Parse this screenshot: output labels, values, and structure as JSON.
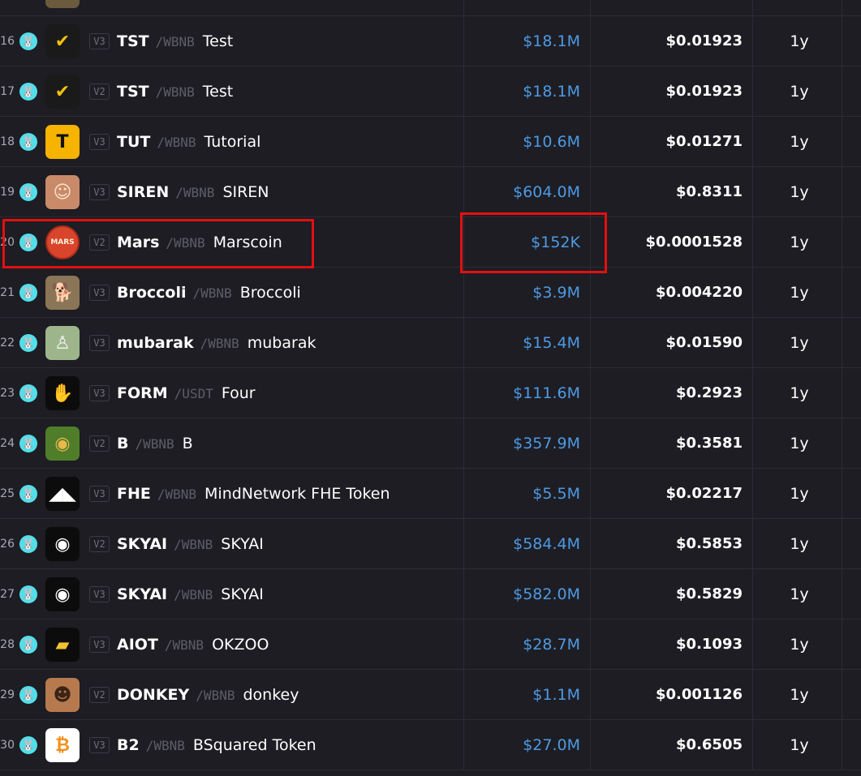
{
  "colors": {
    "background": "#1d1d23",
    "divider": "#2c2c34",
    "liquidity_text": "#4e9ae4",
    "highlight": "#e31010",
    "chain_badge": "#53dee9"
  },
  "rows": [
    {
      "index": "",
      "logo_icon": "partial-logo-icon",
      "logo_bg": "#6b5a3e",
      "logo_fg": "#d6b87a",
      "logo_glyph": "",
      "version": "",
      "symbol": "",
      "pair": "",
      "name": "",
      "liquidity": "",
      "price": "",
      "age": ""
    },
    {
      "index": "16",
      "logo_icon": "checkmark-logo-icon",
      "logo_bg": "#1a1a1a",
      "logo_fg": "#f4c20d",
      "logo_glyph": "✔",
      "version": "V3",
      "symbol": "TST",
      "pair": "/WBNB",
      "name": "Test",
      "liquidity": "$18.1M",
      "price": "$0.01923",
      "age": "1y"
    },
    {
      "index": "17",
      "logo_icon": "checkmark-logo-icon",
      "logo_bg": "#1a1a1a",
      "logo_fg": "#f4c20d",
      "logo_glyph": "✔",
      "version": "V2",
      "symbol": "TST",
      "pair": "/WBNB",
      "name": "Test",
      "liquidity": "$18.1M",
      "price": "$0.01923",
      "age": "1y"
    },
    {
      "index": "18",
      "logo_icon": "tutorial-t-logo-icon",
      "logo_bg": "#f6b300",
      "logo_fg": "#111111",
      "logo_glyph": "T",
      "version": "V3",
      "symbol": "TUT",
      "pair": "/WBNB",
      "name": "Tutorial",
      "liquidity": "$10.6M",
      "price": "$0.01271",
      "age": "1y"
    },
    {
      "index": "19",
      "logo_icon": "siren-character-logo-icon",
      "logo_bg": "#c98a6a",
      "logo_fg": "#fbe1c8",
      "logo_glyph": "☺",
      "version": "V3",
      "symbol": "SIREN",
      "pair": "/WBNB",
      "name": "SIREN",
      "liquidity": "$604.0M",
      "price": "$0.8311",
      "age": "1y"
    },
    {
      "index": "20",
      "logo_icon": "mars-planet-logo-icon",
      "logo_bg": "#d9452b",
      "logo_fg": "#fff2dd",
      "logo_glyph": "MARS",
      "version": "V2",
      "symbol": "Mars",
      "pair": "/WBNB",
      "name": "Marscoin",
      "liquidity": "$152K",
      "price": "$0.0001528",
      "age": "1y"
    },
    {
      "index": "21",
      "logo_icon": "broccoli-dog-logo-icon",
      "logo_bg": "#8a7556",
      "logo_fg": "#2a2018",
      "logo_glyph": "🐕",
      "version": "V3",
      "symbol": "Broccoli",
      "pair": "/WBNB",
      "name": "Broccoli",
      "liquidity": "$3.9M",
      "price": "$0.004220",
      "age": "1y"
    },
    {
      "index": "22",
      "logo_icon": "mubarak-figure-logo-icon",
      "logo_bg": "#9eb58c",
      "logo_fg": "#f3f3f3",
      "logo_glyph": "♙",
      "version": "V3",
      "symbol": "mubarak",
      "pair": "/WBNB",
      "name": "mubarak",
      "liquidity": "$15.4M",
      "price": "$0.01590",
      "age": "1y"
    },
    {
      "index": "23",
      "logo_icon": "four-hand-logo-icon",
      "logo_bg": "#0c0c0c",
      "logo_fg": "#22e37a",
      "logo_glyph": "✋",
      "version": "V3",
      "symbol": "FORM",
      "pair": "/USDT",
      "name": "Four",
      "liquidity": "$111.6M",
      "price": "$0.2923",
      "age": "1y"
    },
    {
      "index": "24",
      "logo_icon": "b-coin-logo-icon",
      "logo_bg": "#4f7d2a",
      "logo_fg": "#e8b84a",
      "logo_glyph": "◉",
      "version": "V2",
      "symbol": "B",
      "pair": "/WBNB",
      "name": "B",
      "liquidity": "$357.9M",
      "price": "$0.3581",
      "age": "1y"
    },
    {
      "index": "25",
      "logo_icon": "mindnetwork-logo-icon",
      "logo_bg": "#0c0c0c",
      "logo_fg": "#ffffff",
      "logo_glyph": "◢◣",
      "version": "V3",
      "symbol": "FHE",
      "pair": "/WBNB",
      "name": "MindNetwork FHE Token",
      "liquidity": "$5.5M",
      "price": "$0.02217",
      "age": "1y"
    },
    {
      "index": "26",
      "logo_icon": "skyai-eye-logo-icon",
      "logo_bg": "#0c0c0c",
      "logo_fg": "#ffffff",
      "logo_glyph": "◉",
      "version": "V2",
      "symbol": "SKYAI",
      "pair": "/WBNB",
      "name": "SKYAI",
      "liquidity": "$584.4M",
      "price": "$0.5853",
      "age": "1y"
    },
    {
      "index": "27",
      "logo_icon": "skyai-eye-logo-icon",
      "logo_bg": "#0c0c0c",
      "logo_fg": "#ffffff",
      "logo_glyph": "◉",
      "version": "V3",
      "symbol": "SKYAI",
      "pair": "/WBNB",
      "name": "SKYAI",
      "liquidity": "$582.0M",
      "price": "$0.5829",
      "age": "1y"
    },
    {
      "index": "28",
      "logo_icon": "okzoo-cheese-logo-icon",
      "logo_bg": "#0c0c0c",
      "logo_fg": "#f2c12e",
      "logo_glyph": "▰",
      "version": "V3",
      "symbol": "AIOT",
      "pair": "/WBNB",
      "name": "OKZOO",
      "liquidity": "$28.7M",
      "price": "$0.1093",
      "age": "1y"
    },
    {
      "index": "29",
      "logo_icon": "donkey-face-logo-icon",
      "logo_bg": "#b77a4e",
      "logo_fg": "#3b2416",
      "logo_glyph": "☻",
      "version": "V2",
      "symbol": "DONKEY",
      "pair": "/WBNB",
      "name": "donkey",
      "liquidity": "$1.1M",
      "price": "$0.001126",
      "age": "1y"
    },
    {
      "index": "30",
      "logo_icon": "bsquared-bitcoin-logo-icon",
      "logo_bg": "#ffffff",
      "logo_fg": "#f2901c",
      "logo_glyph": "₿",
      "version": "V3",
      "symbol": "B2",
      "pair": "/WBNB",
      "name": "BSquared Token",
      "liquidity": "$27.0M",
      "price": "$0.6505",
      "age": "1y"
    }
  ],
  "highlights": [
    {
      "target": "mars-token-name"
    },
    {
      "target": "mars-liquidity"
    }
  ]
}
